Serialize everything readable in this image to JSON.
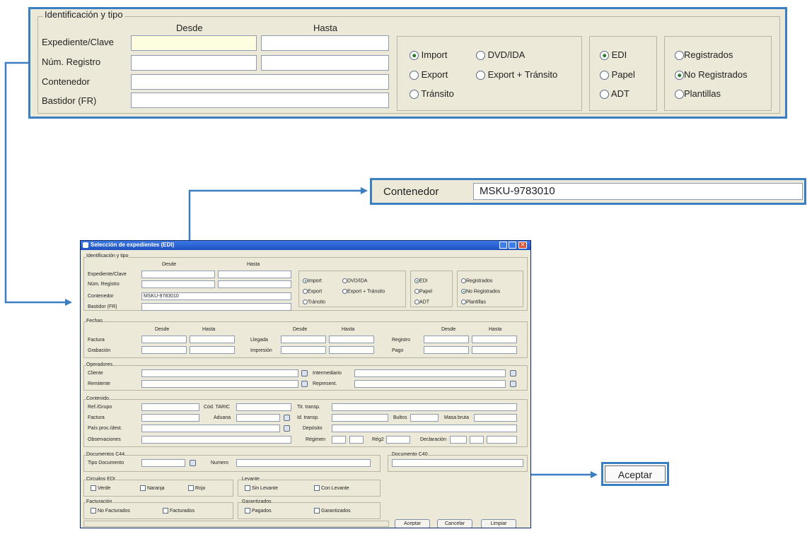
{
  "colors": {
    "callout_blue": "#3a7fc1",
    "panel_bg": "#ece9d8",
    "title_bar": "#2156c9"
  },
  "id_section": {
    "legend": "Identificación y tipo",
    "desde": "Desde",
    "hasta": "Hasta",
    "rows": [
      {
        "label": "Expediente/Clave",
        "desde": "",
        "hasta": ""
      },
      {
        "label": "Núm. Registro",
        "desde": "",
        "hasta": ""
      },
      {
        "label": "Contenedor",
        "value": ""
      },
      {
        "label": "Bastidor (FR)",
        "value": ""
      }
    ],
    "tipo_options": [
      {
        "label": "Import",
        "selected": true
      },
      {
        "label": "DVD/IDA",
        "selected": false
      },
      {
        "label": "Export",
        "selected": false
      },
      {
        "label": "Export + Tránsito",
        "selected": false
      },
      {
        "label": "Tránsito",
        "selected": false
      }
    ],
    "canal_options": [
      {
        "label": "EDI",
        "selected": true
      },
      {
        "label": "Papel",
        "selected": false
      },
      {
        "label": "ADT",
        "selected": false
      }
    ],
    "estado_options": [
      {
        "label": "Registrados",
        "selected": false
      },
      {
        "label": "No Registrados",
        "selected": true
      },
      {
        "label": "Plantillas",
        "selected": false
      }
    ]
  },
  "callout_contenedor": {
    "label": "Contenedor",
    "value": "MSKU-9783010"
  },
  "callout_aceptar": {
    "label": "Aceptar"
  },
  "window": {
    "title": "Selección de expedientes (EDI)",
    "contenedor_value": "MSKU-9783010",
    "fechas": {
      "legend": "Fechas",
      "desde": "Desde",
      "hasta": "Hasta",
      "labels": [
        "Factura",
        "Grabación",
        "Llegada",
        "Impresión",
        "Registro",
        "Pago"
      ]
    },
    "operadores": {
      "legend": "Operadores",
      "labels": [
        "Cliente",
        "Remitente",
        "Intermediario",
        "Represent."
      ]
    },
    "contenido": {
      "legend": "Contenido",
      "labels": [
        "Ref./Grupo",
        "Cód. TARIC",
        "Tit. transp.",
        "Factura",
        "Aduana",
        "Id. transp.",
        "Bultos",
        "Masa bruta",
        "País proc./dest.",
        "Depósito",
        "Observaciones",
        "Régimen",
        "Rég2",
        "Declaración"
      ]
    },
    "documentos_c44": {
      "legend": "Documentos C44",
      "tipo_label": "Tipo Documento",
      "numero_label": "Numero"
    },
    "documento_c40": {
      "legend": "Documento C40"
    },
    "circuitos": {
      "legend": "Circuitos EDI",
      "options": [
        "Verde",
        "Naranja",
        "Rojo"
      ]
    },
    "levante": {
      "legend": "Levante",
      "options": [
        "Sin Levante",
        "Con Levante"
      ]
    },
    "facturacion": {
      "legend": "Facturación",
      "options": [
        "No Facturados",
        "Facturados"
      ]
    },
    "garantizados": {
      "legend": "Garantizados",
      "options": [
        "Pagados",
        "Garantizados"
      ]
    },
    "buttons": {
      "aceptar": "Aceptar",
      "cancelar": "Cancelar",
      "limpiar": "Limpiar"
    }
  }
}
